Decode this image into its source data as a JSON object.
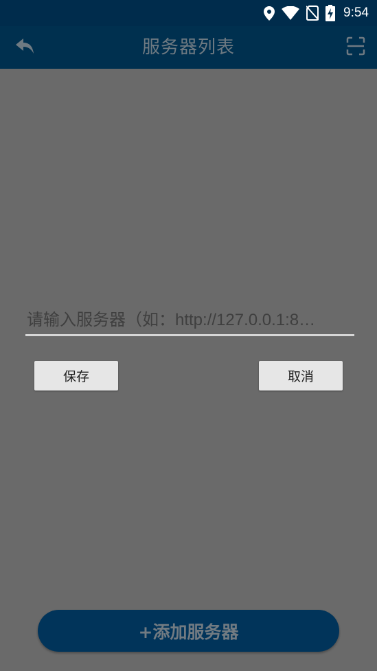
{
  "status_bar": {
    "time": "9:54",
    "icons": [
      "location-icon",
      "wifi-icon",
      "no-sim-icon",
      "battery-charging-icon"
    ]
  },
  "toolbar": {
    "title": "服务器列表",
    "back_icon": "back-arrow-icon",
    "scan_icon": "scan-icon"
  },
  "dialog": {
    "input_value": "",
    "input_placeholder": "请输入服务器（如：http://127.0.0.1:8…",
    "save_label": "保存",
    "cancel_label": "取消"
  },
  "footer": {
    "add_server_label": "+添加服务器"
  },
  "colors": {
    "status_bar": "#002c4c",
    "toolbar": "#00304f",
    "overlay_background": "#6a6a6a",
    "button": "#e6e6e6",
    "add_button": "#01345a"
  }
}
